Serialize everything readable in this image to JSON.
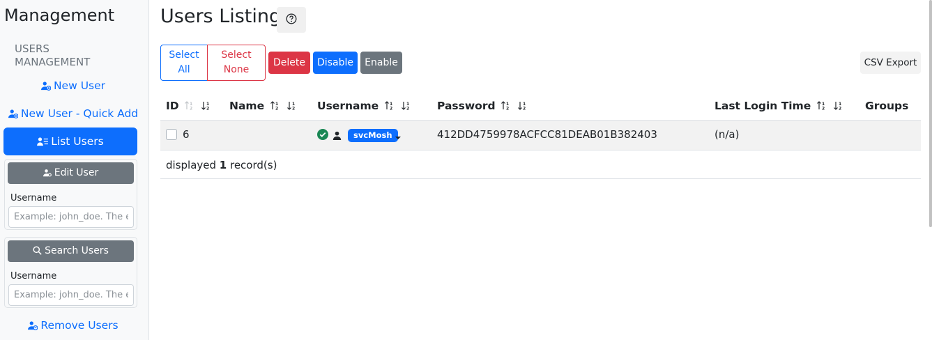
{
  "sidebar": {
    "title": "Management",
    "section_heading": "USERS MANAGEMENT",
    "new_user": "New User",
    "new_user_quick_add": "New User - Quick Add",
    "list_users": "List Users",
    "edit_user_card": {
      "button_label": "Edit User",
      "field_label": "Username",
      "placeholder": "Example: john_doe. The exact username"
    },
    "search_users_card": {
      "button_label": "Search Users",
      "field_label": "Username",
      "placeholder": "Example: john_doe. The exact username"
    },
    "remove_users": "Remove Users"
  },
  "main": {
    "title": "Users Listing",
    "help_icon": "question-circle-icon",
    "toolbar": {
      "select_all_line1": "Select",
      "select_all_line2": "All",
      "select_none_line1": "Select",
      "select_none_line2": "None",
      "delete": "Delete",
      "disable": "Disable",
      "enable": "Enable",
      "csv_export": "CSV Export"
    },
    "table": {
      "columns": [
        "ID",
        "Name",
        "Username",
        "Password",
        "Last Login Time",
        "Groups"
      ],
      "rows": [
        {
          "id": "6",
          "name": "",
          "username": "svcMosh",
          "password": "412DD4759978ACFCC81DEAB01B382403",
          "last_login": "(n/a)",
          "groups": ""
        }
      ]
    },
    "footer": {
      "prefix": "displayed ",
      "count": "1",
      "suffix": " record(s)"
    }
  },
  "colors": {
    "primary": "#0d6efd",
    "danger": "#dc3545",
    "secondary": "#6c757d",
    "success": "#198754"
  }
}
